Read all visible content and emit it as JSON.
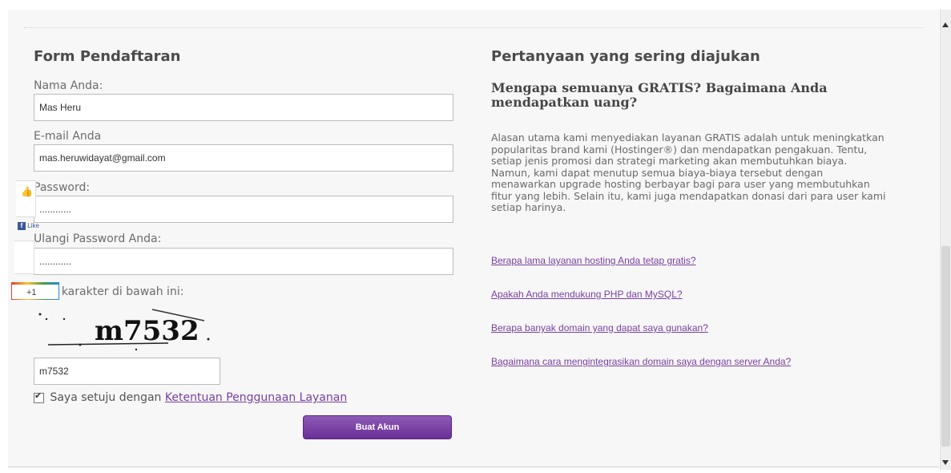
{
  "form": {
    "title": "Form Pendaftaran",
    "name_label": "Nama Anda:",
    "name_value": "Mas Heru",
    "email_label": "E-mail Anda",
    "email_value": "mas.heruwidayat@gmail.com",
    "password_label": "Password:",
    "password_value": "............",
    "confirm_label": "Ulangi Password Anda:",
    "confirm_value": "............",
    "captcha_label": "Tulis karakter di bawah ini:",
    "captcha_text": "m7532",
    "captcha_input": "m7532",
    "agree_text": "Saya setuju dengan",
    "agree_link": "Ketentuan Penggunaan Layanan",
    "agree_checked": true,
    "submit_label": "Buat Akun"
  },
  "faq": {
    "title": "Pertanyaan yang sering diajukan",
    "question": "Mengapa semuanya GRATIS? Bagaimana Anda mendapatkan uang?",
    "answer": "Alasan utama kami menyediakan layanan GRATIS adalah untuk meningkatkan popularitas brand kami (Hostinger®) dan mendapatkan pengakuan. Tentu, setiap jenis promosi dan strategi marketing akan membutuhkan biaya. Namun, kami dapat menutup semua biaya-biaya tersebut dengan menawarkan upgrade hosting berbayar bagi para user yang membutuhkan fitur yang lebih. Selain itu, kami juga mendapatkan donasi dari para user kami setiap harinya.",
    "links": [
      "Berapa lama layanan hosting Anda tetap gratis?",
      "Apakah Anda mendukung PHP dan MySQL?",
      "Berapa banyak domain yang dapat saya gunakan?",
      "Bagaimana cara mengintegrasikan domain saya dengan server Anda?"
    ]
  },
  "social": {
    "like_label": "Like",
    "gplus_label": "+1"
  },
  "colors": {
    "accent": "#7a3fa0",
    "button": "#6a2f96",
    "panel": "#f7f7f7"
  }
}
